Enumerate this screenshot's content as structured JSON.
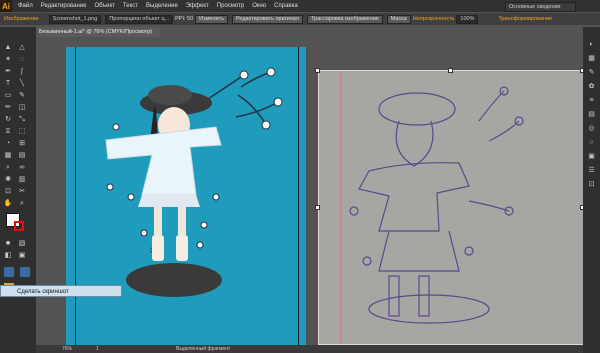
{
  "app": {
    "logo": "Ai",
    "workspace": "Основные сведения"
  },
  "menu": [
    "Файл",
    "Редактирование",
    "Объект",
    "Текст",
    "Выделение",
    "Эффект",
    "Просмотр",
    "Окно",
    "Справка"
  ],
  "optbar": {
    "label": "Изображение",
    "file": "Screenshot_1.png",
    "color": "Пропорцион объект ц...",
    "ppi": "PPI: 50",
    "edit": "Изменить",
    "original_rule": "Редактировать оригинал",
    "trace": "Трассировка изображения",
    "mask": "Маска",
    "opacity_label": "Непрозрачность",
    "opacity_value": "100%",
    "transform": "Трансформирование"
  },
  "document": {
    "tab": "Безымянный-1.ai* @ 76% (CMYK/Просмотр)"
  },
  "status": {
    "zoom": "76%",
    "page": "1",
    "tool": "Выделенный фрагмент"
  },
  "tooltip": {
    "text": "Сделать скриншот"
  },
  "colors": {
    "artboard": "#1f9bbb",
    "photo": "#a8a6a3",
    "accent": "#f3a224"
  }
}
